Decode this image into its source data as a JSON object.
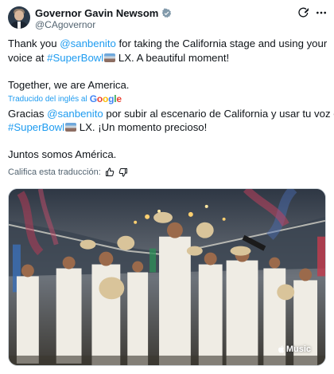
{
  "author": {
    "display_name": "Governor Gavin Newsom",
    "handle": "@CAgovernor"
  },
  "tweet": {
    "line1_pre": "Thank you ",
    "line1_mention": "@sanbenito",
    "line1_post": " for taking the California stage and using your",
    "line2_pre": "voice at ",
    "line2_hashtag": "#SuperBowl",
    "line2_post": " LX. A beautiful moment!",
    "line3": "Together, we are America."
  },
  "translation": {
    "label": "Traducido del inglés al",
    "provider": "Google",
    "line1_pre": "Gracias ",
    "line1_mention": "@sanbenito",
    "line1_post": " por subir al escenario de California y usar tu voz en",
    "line2_hashtag": "#SuperBowl",
    "line2_post": " LX. ¡Un momento precioso!",
    "line3": "Juntos somos América.",
    "rate_label": "Califica esta traducción:"
  },
  "media": {
    "watermark": "Music"
  },
  "icons": {
    "verified": "verified-badge-icon",
    "grok": "grok-icon",
    "more": "more-options-icon",
    "thumbs_up": "thumbs-up-icon",
    "thumbs_down": "thumbs-down-icon",
    "apple": "apple-logo-icon"
  },
  "colors": {
    "link": "#1d9bf0",
    "text": "#0f1419",
    "secondary": "#536471"
  }
}
